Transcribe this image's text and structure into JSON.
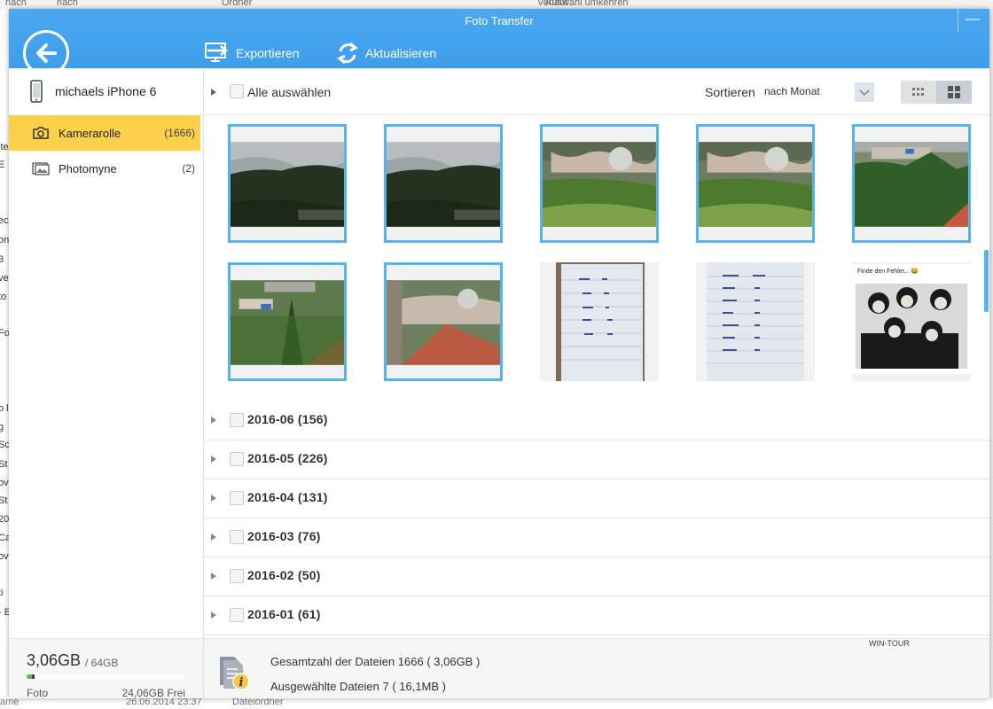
{
  "background": {
    "top_items": [
      "nach",
      "nach",
      "Ordner",
      "Verlauf",
      "Auswahl umkehren"
    ],
    "left_fragments": [
      "ite",
      "E",
      "ec",
      "on",
      "3",
      "ve",
      "to",
      "Fo",
      "o l",
      "g",
      "Sc",
      "St",
      "ov",
      "St",
      "20",
      "Ca",
      "ov",
      "ti",
      "- E"
    ],
    "bottom_items": [
      "ame",
      "26.06.2014 23:37",
      "Dateiordner"
    ]
  },
  "window": {
    "title": "Foto Transfer",
    "minimize_glyph": "—",
    "toolbar": {
      "export_label": "Exportieren",
      "refresh_label": "Aktualisieren"
    }
  },
  "sidebar": {
    "device_name": "michaels iPhone 6",
    "items": [
      {
        "label": "Kamerarolle",
        "count": "(1666)",
        "icon": "camera-icon",
        "selected": true
      },
      {
        "label": "Photomyne",
        "count": "(2)",
        "icon": "picture-icon",
        "selected": false
      }
    ],
    "storage": {
      "used": "3,06GB",
      "total": "/ 64GB",
      "used_fraction": 0.048,
      "label": "Foto",
      "free": "24,06GB Frei"
    }
  },
  "main": {
    "select_all_label": "Alle auswählen",
    "sort_label": "Sortieren",
    "sort_value": "nach Monat",
    "photos": [
      {
        "type": "forest-sky",
        "selected": true
      },
      {
        "type": "forest-sky",
        "selected": true
      },
      {
        "type": "village-smoke",
        "selected": true
      },
      {
        "type": "village-smoke",
        "selected": true
      },
      {
        "type": "village-roof",
        "selected": true
      },
      {
        "type": "village-roof-2",
        "selected": true
      },
      {
        "type": "tower-village",
        "selected": true
      },
      {
        "type": "notebook",
        "selected": false
      },
      {
        "type": "notebook-2",
        "selected": false
      },
      {
        "type": "beatles",
        "selected": false,
        "caption": "Finde den Fehler... 😂"
      }
    ],
    "groups": [
      {
        "label": "2016-06 (156)"
      },
      {
        "label": "2016-05 (226)"
      },
      {
        "label": "2016-04 (131)"
      },
      {
        "label": "2016-03 (76)"
      },
      {
        "label": "2016-02 (50)"
      },
      {
        "label": "2016-01 (61)"
      }
    ],
    "footer": {
      "total_label": "Gesamtzahl der Dateien  1666  ( 3,06GB )",
      "selected_label": "Ausgewählte Dateien  7  ( 16,1MB )",
      "watermark": "WIN-TOUR"
    }
  },
  "colors": {
    "titlebar": "#45a5f0",
    "selection": "#55b4ee",
    "active_item": "#fcd04b"
  }
}
